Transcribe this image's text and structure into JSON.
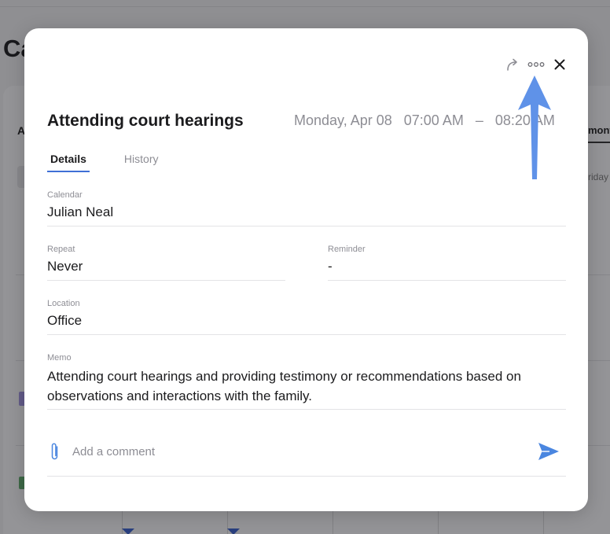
{
  "background": {
    "page_title_partial": "Ca",
    "tab_partial": "A",
    "view_partial": "mont",
    "day_partial": "riday"
  },
  "modal": {
    "actions": {
      "forward_icon": "forward-arrow-icon",
      "more_icon": "more-dots-icon",
      "close_icon": "close-icon"
    },
    "title": "Attending court hearings",
    "date": "Monday, Apr 08",
    "start_time": "07:00 AM",
    "separator": "–",
    "end_time": "08:20 AM",
    "tabs": [
      {
        "label": "Details",
        "active": true
      },
      {
        "label": "History",
        "active": false
      }
    ],
    "fields": {
      "calendar": {
        "label": "Calendar",
        "value": "Julian Neal"
      },
      "repeat": {
        "label": "Repeat",
        "value": "Never"
      },
      "reminder": {
        "label": "Reminder",
        "value": "-"
      },
      "location": {
        "label": "Location",
        "value": "Office"
      },
      "memo": {
        "label": "Memo",
        "value": "Attending court hearings and providing testimony or recommendations based on observations and interactions with the family."
      }
    },
    "comment": {
      "placeholder": "Add a comment",
      "value": ""
    }
  },
  "colors": {
    "accent": "#3f6fd6",
    "send_icon": "#4a86e0",
    "pointer_arrow": "#5f92e8",
    "muted_text": "#8d8d94"
  }
}
